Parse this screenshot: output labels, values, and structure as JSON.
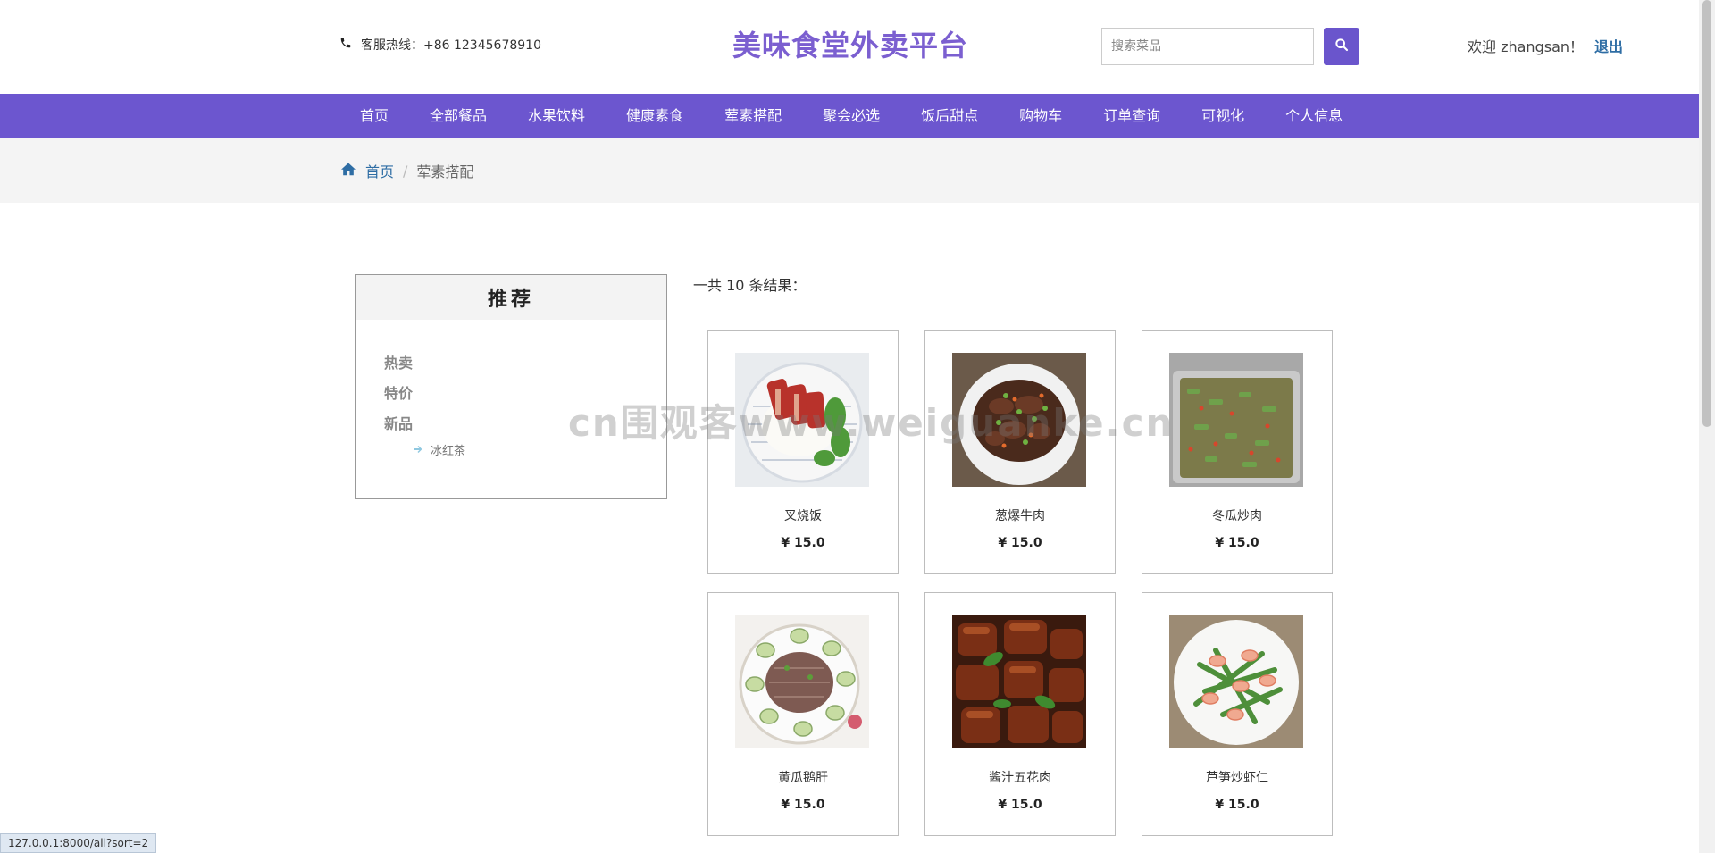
{
  "header": {
    "hotline_label": "客服热线：+86 12345678910",
    "site_title": "美味食堂外卖平台",
    "search_placeholder": "搜索菜品",
    "welcome": "欢迎 zhangsan！",
    "logout": "退出"
  },
  "nav": [
    "首页",
    "全部餐品",
    "水果饮料",
    "健康素食",
    "荤素搭配",
    "聚会必选",
    "饭后甜点",
    "购物车",
    "订单查询",
    "可视化",
    "个人信息"
  ],
  "breadcrumb": {
    "home": "首页",
    "separator": "/",
    "current": "荤素搭配"
  },
  "sidebar": {
    "title": "推荐",
    "categories": [
      "热卖",
      "特价",
      "新品"
    ],
    "sub_item": "冰红茶"
  },
  "results": {
    "count_text": "一共 10 条结果：",
    "items": [
      {
        "name": "叉烧饭",
        "price": "¥ 15.0"
      },
      {
        "name": "葱爆牛肉",
        "price": "¥ 15.0"
      },
      {
        "name": "冬瓜炒肉",
        "price": "¥ 15.0"
      },
      {
        "name": "黄瓜鹅肝",
        "price": "¥ 15.0"
      },
      {
        "name": "酱汁五花肉",
        "price": "¥ 15.0"
      },
      {
        "name": "芦笋炒虾仁",
        "price": "¥ 15.0"
      }
    ]
  },
  "watermark": "cn围观客www.weiguanke.cn",
  "statusbar": "127.0.0.1:8000/all?sort=2",
  "colors": {
    "brand": "#6c56cf",
    "title": "#7b5fd0",
    "link": "#2e6da4"
  }
}
